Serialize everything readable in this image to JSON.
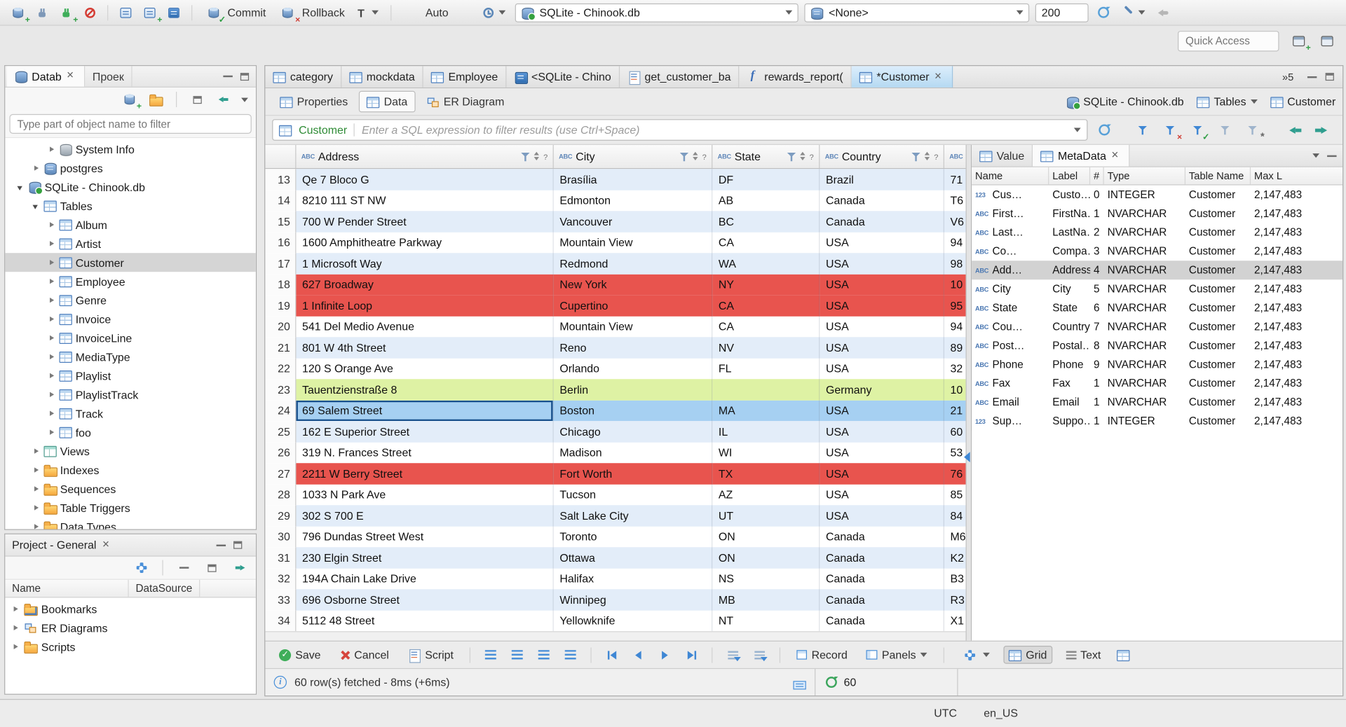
{
  "topbar": {
    "commit_label": "Commit",
    "rollback_label": "Rollback",
    "auto_label": "Auto",
    "connection_combo": "SQLite - Chinook.db",
    "schema_combo": "<None>",
    "fetch_size_value": "200",
    "quick_access_placeholder": "Quick Access"
  },
  "navigator": {
    "tabs": [
      {
        "label": "Datab"
      },
      {
        "label": "Проек"
      }
    ],
    "filter_placeholder": "Type part of object name to filter",
    "tree": [
      {
        "label": "System Info",
        "cls": "lv2",
        "arrow": "collapsed",
        "icon": "ico-dbsys"
      },
      {
        "label": "postgres",
        "cls": "lv1",
        "arrow": "collapsed",
        "icon": "ico-dbstack"
      },
      {
        "label": "SQLite - Chinook.db",
        "cls": "lv0",
        "arrow": "expanded",
        "icon": "ico-dbcheck"
      },
      {
        "label": "Tables",
        "cls": "lv1",
        "arrow": "expanded",
        "icon": "ico-table"
      },
      {
        "label": "Album",
        "cls": "lv2",
        "arrow": "collapsed",
        "icon": "ico-table"
      },
      {
        "label": "Artist",
        "cls": "lv2",
        "arrow": "collapsed",
        "icon": "ico-table"
      },
      {
        "label": "Customer",
        "cls": "lv2 selected",
        "arrow": "collapsed",
        "icon": "ico-table"
      },
      {
        "label": "Employee",
        "cls": "lv2",
        "arrow": "collapsed",
        "icon": "ico-table"
      },
      {
        "label": "Genre",
        "cls": "lv2",
        "arrow": "collapsed",
        "icon": "ico-table"
      },
      {
        "label": "Invoice",
        "cls": "lv2",
        "arrow": "collapsed",
        "icon": "ico-table"
      },
      {
        "label": "InvoiceLine",
        "cls": "lv2",
        "arrow": "collapsed",
        "icon": "ico-table"
      },
      {
        "label": "MediaType",
        "cls": "lv2",
        "arrow": "collapsed",
        "icon": "ico-table"
      },
      {
        "label": "Playlist",
        "cls": "lv2",
        "arrow": "collapsed",
        "icon": "ico-table"
      },
      {
        "label": "PlaylistTrack",
        "cls": "lv2",
        "arrow": "collapsed",
        "icon": "ico-table"
      },
      {
        "label": "Track",
        "cls": "lv2",
        "arrow": "collapsed",
        "icon": "ico-table"
      },
      {
        "label": "foo",
        "cls": "lv2",
        "arrow": "collapsed",
        "icon": "ico-table"
      },
      {
        "label": "Views",
        "cls": "lv1",
        "arrow": "collapsed",
        "icon": "ico-view"
      },
      {
        "label": "Indexes",
        "cls": "lv1",
        "arrow": "collapsed",
        "icon": "ico-folder"
      },
      {
        "label": "Sequences",
        "cls": "lv1",
        "arrow": "collapsed",
        "icon": "ico-folder"
      },
      {
        "label": "Table Triggers",
        "cls": "lv1",
        "arrow": "collapsed",
        "icon": "ico-folder"
      },
      {
        "label": "Data Types",
        "cls": "lv1",
        "arrow": "collapsed",
        "icon": "ico-folder"
      }
    ]
  },
  "project_panel": {
    "title": "Project - General",
    "columns": {
      "name": "Name",
      "datasource": "DataSource"
    },
    "items": [
      {
        "label": "Bookmarks",
        "icon": "ico-folder-bm"
      },
      {
        "label": "ER Diagrams",
        "icon": "ico-erd"
      },
      {
        "label": "Scripts",
        "icon": "ico-folder"
      }
    ]
  },
  "editor": {
    "tabs": [
      {
        "label": "category",
        "icon": "ico-table"
      },
      {
        "label": "mockdata",
        "icon": "ico-table"
      },
      {
        "label": "Employee",
        "icon": "ico-table"
      },
      {
        "label": "<SQLite - Chino",
        "icon": "ico-sqlcon"
      },
      {
        "label": "get_customer_ba",
        "icon": "ico-sqlfile"
      },
      {
        "label": "rewards_report(",
        "icon": "ico-fn"
      },
      {
        "label": "*Customer",
        "icon": "ico-table",
        "cls": "active",
        "closable": true
      }
    ],
    "overflow_label": "»5",
    "subtabs": [
      {
        "label": "Properties",
        "icon": "ico-table"
      },
      {
        "label": "Data",
        "icon": "ico-table",
        "cls": "active"
      },
      {
        "label": "ER Diagram",
        "icon": "ico-erd"
      }
    ],
    "context_connection": "SQLite - Chinook.db",
    "context_container": "Tables",
    "context_object": "Customer"
  },
  "filterbar": {
    "entity": "Customer",
    "placeholder": "Enter a SQL expression to filter results (use Ctrl+Space)"
  },
  "grid": {
    "header": {
      "c1": "Address",
      "c2": "City",
      "c3": "State",
      "c4": "Country"
    },
    "rows": [
      {
        "num": "13",
        "address": "Qe 7 Bloco G",
        "city": "Brasília",
        "state": "DF",
        "country": "Brazil",
        "extra": "71",
        "bg": "stripe"
      },
      {
        "num": "14",
        "address": "8210 111 ST NW",
        "city": "Edmonton",
        "state": "AB",
        "country": "Canada",
        "extra": "T6",
        "bg": "plain"
      },
      {
        "num": "15",
        "address": "700 W Pender Street",
        "city": "Vancouver",
        "state": "BC",
        "country": "Canada",
        "extra": "V6",
        "bg": "stripe"
      },
      {
        "num": "16",
        "address": "1600 Amphitheatre Parkway",
        "city": "Mountain View",
        "state": "CA",
        "country": "USA",
        "extra": "94",
        "bg": "plain"
      },
      {
        "num": "17",
        "address": "1 Microsoft Way",
        "city": "Redmond",
        "state": "WA",
        "country": "USA",
        "extra": "98",
        "bg": "stripe"
      },
      {
        "num": "18",
        "address": "627 Broadway",
        "city": "New York",
        "state": "NY",
        "country": "USA",
        "extra": "10",
        "bg": "red"
      },
      {
        "num": "19",
        "address": "1 Infinite Loop",
        "city": "Cupertino",
        "state": "CA",
        "country": "USA",
        "extra": "95",
        "bg": "red"
      },
      {
        "num": "20",
        "address": "541 Del Medio Avenue",
        "city": "Mountain View",
        "state": "CA",
        "country": "USA",
        "extra": "94",
        "bg": "plain"
      },
      {
        "num": "21",
        "address": "801 W 4th Street",
        "city": "Reno",
        "state": "NV",
        "country": "USA",
        "extra": "89",
        "bg": "stripe"
      },
      {
        "num": "22",
        "address": "120 S Orange Ave",
        "city": "Orlando",
        "state": "FL",
        "country": "USA",
        "extra": "32",
        "bg": "plain"
      },
      {
        "num": "23",
        "address": "Tauentzienstraße 8",
        "city": "Berlin",
        "state": "",
        "country": "Germany",
        "extra": "10",
        "bg": "green"
      },
      {
        "num": "24",
        "address": "69 Salem Street",
        "city": "Boston",
        "state": "MA",
        "country": "USA",
        "extra": "21",
        "bg": "sel"
      },
      {
        "num": "25",
        "address": "162 E Superior Street",
        "city": "Chicago",
        "state": "IL",
        "country": "USA",
        "extra": "60",
        "bg": "stripe"
      },
      {
        "num": "26",
        "address": "319 N. Frances Street",
        "city": "Madison",
        "state": "WI",
        "country": "USA",
        "extra": "53",
        "bg": "plain"
      },
      {
        "num": "27",
        "address": "2211 W Berry Street",
        "city": "Fort Worth",
        "state": "TX",
        "country": "USA",
        "extra": "76",
        "bg": "red"
      },
      {
        "num": "28",
        "address": "1033 N Park Ave",
        "city": "Tucson",
        "state": "AZ",
        "country": "USA",
        "extra": "85",
        "bg": "plain"
      },
      {
        "num": "29",
        "address": "302 S 700 E",
        "city": "Salt Lake City",
        "state": "UT",
        "country": "USA",
        "extra": "84",
        "bg": "stripe"
      },
      {
        "num": "30",
        "address": "796 Dundas Street West",
        "city": "Toronto",
        "state": "ON",
        "country": "Canada",
        "extra": "M6",
        "bg": "plain"
      },
      {
        "num": "31",
        "address": "230 Elgin Street",
        "city": "Ottawa",
        "state": "ON",
        "country": "Canada",
        "extra": "K2",
        "bg": "stripe"
      },
      {
        "num": "32",
        "address": "194A Chain Lake Drive",
        "city": "Halifax",
        "state": "NS",
        "country": "Canada",
        "extra": "B3",
        "bg": "plain"
      },
      {
        "num": "33",
        "address": "696 Osborne Street",
        "city": "Winnipeg",
        "state": "MB",
        "country": "Canada",
        "extra": "R3",
        "bg": "stripe"
      },
      {
        "num": "34",
        "address": "5112 48 Street",
        "city": "Yellowknife",
        "state": "NT",
        "country": "Canada",
        "extra": "X1",
        "bg": "plain"
      }
    ]
  },
  "metapanel": {
    "tabs": [
      {
        "label": "Value"
      },
      {
        "label": "MetaData"
      }
    ],
    "columns": {
      "name": "Name",
      "label": "Label",
      "num": "#",
      "type": "Type",
      "table": "Table Name",
      "max": "Max L"
    },
    "rows": [
      {
        "icon": "t-123",
        "name": "Cus…",
        "label": "Custo…",
        "num": "0",
        "type": "INTEGER",
        "table": "Customer",
        "max": "2,147,483"
      },
      {
        "icon": "t-abc",
        "name": "First…",
        "label": "FirstNa…",
        "num": "1",
        "type": "NVARCHAR",
        "table": "Customer",
        "max": "2,147,483"
      },
      {
        "icon": "t-abc",
        "name": "Last…",
        "label": "LastNa…",
        "num": "2",
        "type": "NVARCHAR",
        "table": "Customer",
        "max": "2,147,483"
      },
      {
        "icon": "t-abc",
        "name": "Co…",
        "label": "Compa…",
        "num": "3",
        "type": "NVARCHAR",
        "table": "Customer",
        "max": "2,147,483"
      },
      {
        "icon": "t-abc",
        "name": "Add…",
        "label": "Address",
        "num": "4",
        "type": "NVARCHAR",
        "table": "Customer",
        "max": "2,147,483",
        "sel": "selected"
      },
      {
        "icon": "t-abc",
        "name": "City",
        "label": "City",
        "num": "5",
        "type": "NVARCHAR",
        "table": "Customer",
        "max": "2,147,483"
      },
      {
        "icon": "t-abc",
        "name": "State",
        "label": "State",
        "num": "6",
        "type": "NVARCHAR",
        "table": "Customer",
        "max": "2,147,483"
      },
      {
        "icon": "t-abc",
        "name": "Cou…",
        "label": "Country",
        "num": "7",
        "type": "NVARCHAR",
        "table": "Customer",
        "max": "2,147,483"
      },
      {
        "icon": "t-abc",
        "name": "Post…",
        "label": "Postal…",
        "num": "8",
        "type": "NVARCHAR",
        "table": "Customer",
        "max": "2,147,483"
      },
      {
        "icon": "t-abc",
        "name": "Phone",
        "label": "Phone",
        "num": "9",
        "type": "NVARCHAR",
        "table": "Customer",
        "max": "2,147,483"
      },
      {
        "icon": "t-abc",
        "name": "Fax",
        "label": "Fax",
        "num": "1",
        "type": "NVARCHAR",
        "table": "Customer",
        "max": "2,147,483"
      },
      {
        "icon": "t-abc",
        "name": "Email",
        "label": "Email",
        "num": "1",
        "type": "NVARCHAR",
        "table": "Customer",
        "max": "2,147,483"
      },
      {
        "icon": "t-123",
        "name": "Sup…",
        "label": "Suppo…",
        "num": "1",
        "type": "INTEGER",
        "table": "Customer",
        "max": "2,147,483"
      }
    ]
  },
  "bottombar": {
    "save": "Save",
    "cancel": "Cancel",
    "script": "Script",
    "record": "Record",
    "panels": "Panels",
    "grid": "Grid",
    "text": "Text"
  },
  "statusrow": {
    "message": "60 row(s) fetched - 8ms (+6ms)",
    "fetch_count": "60"
  },
  "statusbar": {
    "timezone": "UTC",
    "locale": "en_US"
  }
}
